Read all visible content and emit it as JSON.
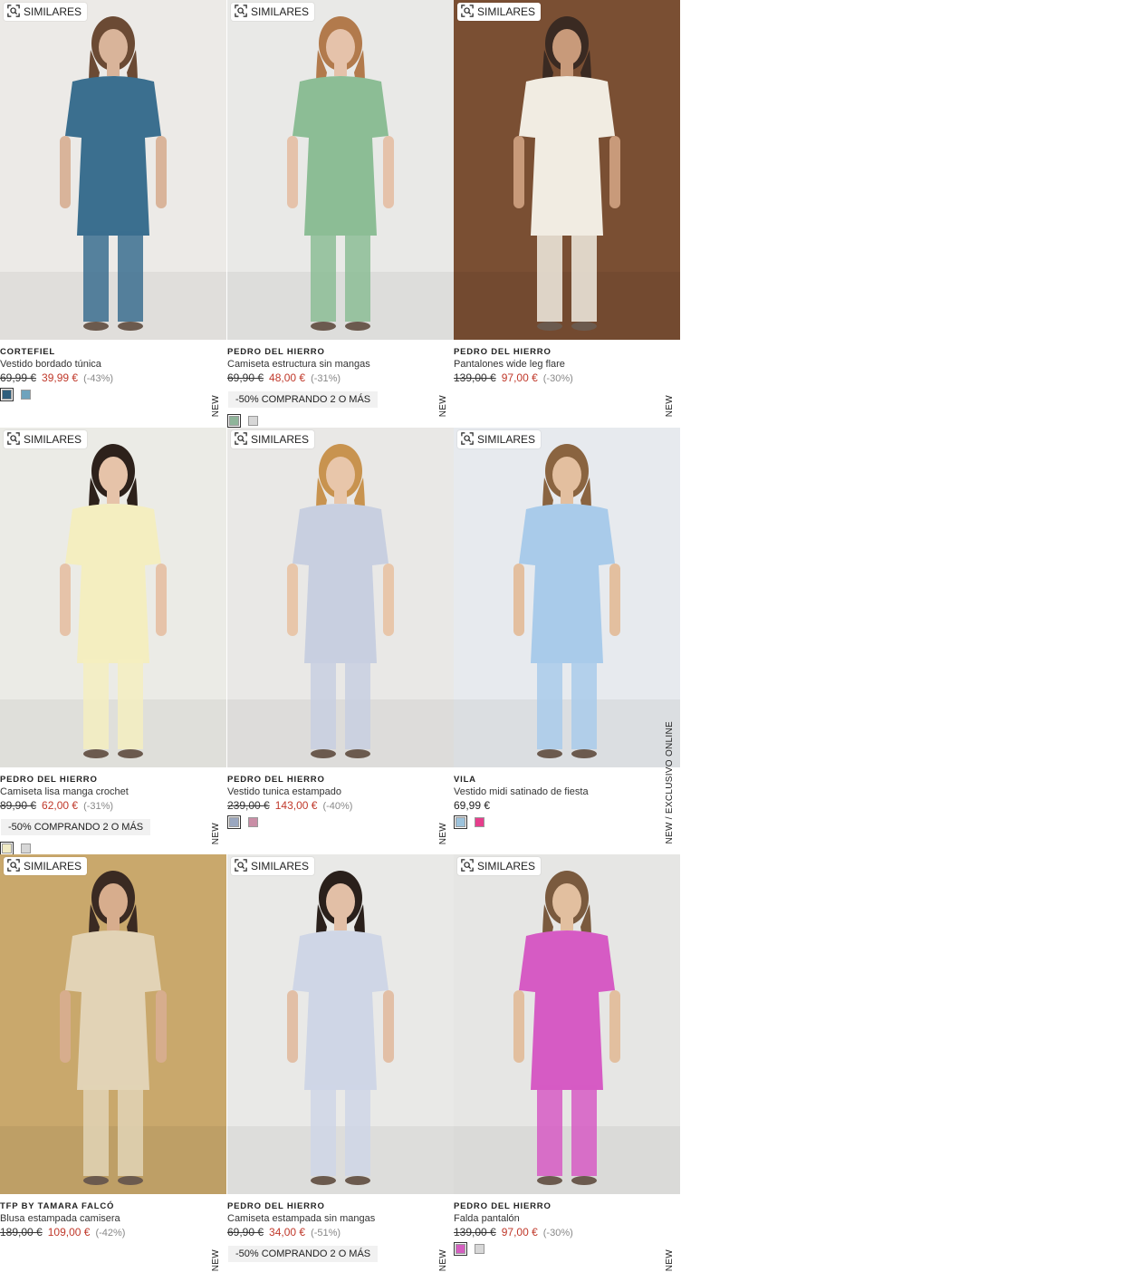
{
  "similar_label": "SIMILARES",
  "products": [
    {
      "brand": "CORTEFIEL",
      "name": "Vestido bordado túnica",
      "old_price": "69,99 €",
      "price": "39,99 €",
      "discount": "(-43%)",
      "promo": "",
      "tag": "NEW",
      "swatches": [
        "#2f5f7d",
        "#6fa3bd"
      ],
      "photo_colors": {
        "bg": "#eceae7",
        "item": "#3b6f8f",
        "skin": "#d9b49a",
        "hair": "#6b4a34"
      }
    },
    {
      "brand": "PEDRO DEL HIERRO",
      "name": "Camiseta estructura sin mangas",
      "old_price": "69,90 €",
      "price": "48,00 €",
      "discount": "(-31%)",
      "promo": "-50% COMPRANDO 2 O MÁS",
      "tag": "NEW",
      "swatches": [
        "#8fb59a",
        "#d7d7d7"
      ],
      "photo_colors": {
        "bg": "#e9e9e7",
        "item": "#8cbd95",
        "skin": "#e5c2aa",
        "hair": "#b27a4c"
      }
    },
    {
      "brand": "PEDRO DEL HIERRO",
      "name": "Pantalones wide leg flare",
      "old_price": "139,00 €",
      "price": "97,00 €",
      "discount": "(-30%)",
      "promo": "",
      "tag": "NEW",
      "swatches": [],
      "photo_colors": {
        "bg": "#7a4f33",
        "item": "#f1ece2",
        "skin": "#c89a7a",
        "hair": "#3a2a22"
      }
    },
    {
      "brand": "PEDRO DEL HIERRO",
      "name": "Camiseta lisa manga crochet",
      "old_price": "89,90 €",
      "price": "62,00 €",
      "discount": "(-31%)",
      "promo": "-50% COMPRANDO 2 O MÁS",
      "tag": "NEW",
      "swatches": [
        "#f2ecc5",
        "#d7d7d7"
      ],
      "photo_colors": {
        "bg": "#ebebe6",
        "item": "#f4eec0",
        "skin": "#e6c3a9",
        "hair": "#2d211b"
      }
    },
    {
      "brand": "PEDRO DEL HIERRO",
      "name": "Vestido tunica estampado",
      "old_price": "239,00 €",
      "price": "143,00 €",
      "discount": "(-40%)",
      "promo": "",
      "tag": "NEW",
      "swatches": [
        "#9aa7c0",
        "#c98ea6"
      ],
      "photo_colors": {
        "bg": "#e9e8e6",
        "item": "#c8cfe0",
        "skin": "#e8c6aa",
        "hair": "#c8934f"
      }
    },
    {
      "brand": "VILA",
      "name": "Vestido midi satinado de fiesta",
      "old_price": "",
      "price": "69,99 €",
      "discount": "",
      "promo": "",
      "tag": "NEW  /  EXCLUSIVO ONLINE",
      "swatches": [
        "#9dc3dc",
        "#e63e8c"
      ],
      "photo_colors": {
        "bg": "#e7eaee",
        "item": "#a9cbea",
        "skin": "#e3bf9f",
        "hair": "#8a6440"
      }
    },
    {
      "brand": "TFP BY TAMARA FALCÓ",
      "name": "Blusa estampada camisera",
      "old_price": "189,00 €",
      "price": "109,00 €",
      "discount": "(-42%)",
      "promo": "",
      "tag": "NEW",
      "swatches": [],
      "photo_colors": {
        "bg": "#c9a86c",
        "item": "#e2d3b6",
        "skin": "#d7ad8d",
        "hair": "#3a2a22"
      }
    },
    {
      "brand": "PEDRO DEL HIERRO",
      "name": "Camiseta estampada sin mangas",
      "old_price": "69,90 €",
      "price": "34,00 €",
      "discount": "(-51%)",
      "promo": "-50% COMPRANDO 2 O MÁS",
      "tag": "NEW",
      "swatches": [],
      "photo_colors": {
        "bg": "#e9e9e7",
        "item": "#cfd6e6",
        "skin": "#e2bfa6",
        "hair": "#2a201b"
      }
    },
    {
      "brand": "PEDRO DEL HIERRO",
      "name": "Falda pantalón",
      "old_price": "139,00 €",
      "price": "97,00 €",
      "discount": "(-30%)",
      "promo": "",
      "tag": "NEW",
      "swatches": [
        "#d45ec0",
        "#d7d7d7"
      ],
      "photo_colors": {
        "bg": "#e6e6e4",
        "item": "#d65bc4",
        "skin": "#e2bf9f",
        "hair": "#7a5a3e"
      }
    }
  ]
}
